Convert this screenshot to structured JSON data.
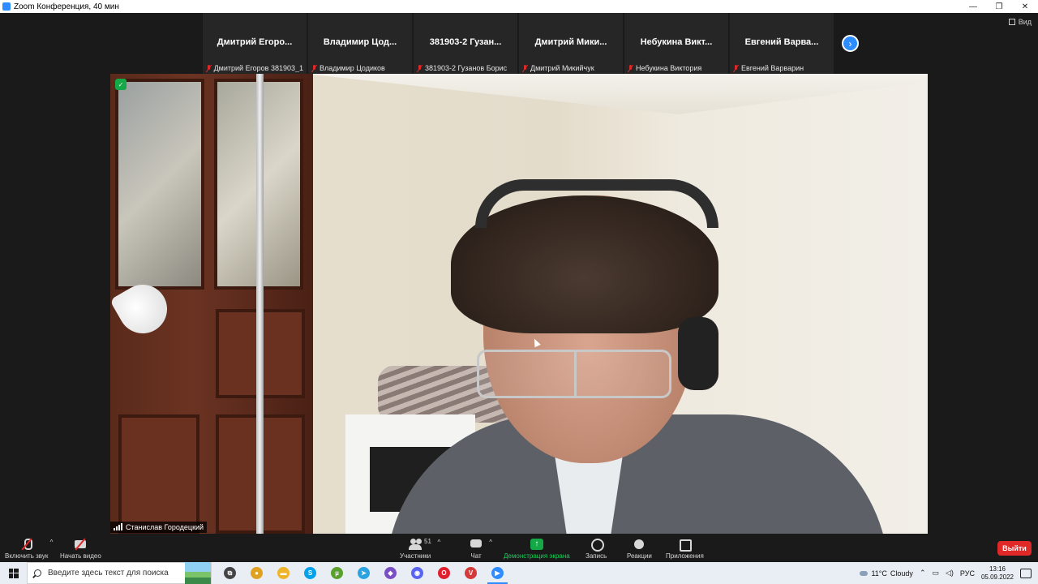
{
  "window": {
    "title": "Zoom Конференция, 40 мин",
    "controls": [
      "—",
      "❐",
      "✕"
    ]
  },
  "view": {
    "label": "Вид"
  },
  "participants_strip": [
    {
      "name": "Дмитрий Егоро...",
      "label": "Дмитрий Егоров 381903_1"
    },
    {
      "name": "Владимир Цод...",
      "label": "Владимир Цодиков"
    },
    {
      "name": "381903-2 Гузан...",
      "label": "381903-2 Гузанов Борис"
    },
    {
      "name": "Дмитрий Мики...",
      "label": "Дмитрий Микийчук"
    },
    {
      "name": "Небукина Викт...",
      "label": "Небукина Виктория"
    },
    {
      "name": "Евгений Варва...",
      "label": "Евгений Варварин"
    }
  ],
  "next_page_icon": "chevron-right-icon",
  "main_video": {
    "speaker_name": "Станислав Городецкий",
    "encryption_icon": "shield-check-icon"
  },
  "controls": {
    "unmute": "Включить звук",
    "start_video": "Начать видео",
    "participants": "Участники",
    "participants_count": "51",
    "chat": "Чат",
    "share_screen": "Демонстрация экрана",
    "record": "Запись",
    "reactions": "Реакции",
    "apps": "Приложения",
    "leave": "Выйти",
    "caret": "^"
  },
  "taskbar": {
    "search_placeholder": "Введите здесь текст для поиска",
    "apps": [
      {
        "name": "task-view",
        "color": "#444444",
        "glyph": "⧉"
      },
      {
        "name": "chrome",
        "color": "#e0a020",
        "glyph": "●"
      },
      {
        "name": "file-explorer",
        "color": "#f0b429",
        "glyph": "▬"
      },
      {
        "name": "skype",
        "color": "#00a2ed",
        "glyph": "S"
      },
      {
        "name": "utorrent",
        "color": "#5aa02c",
        "glyph": "µ"
      },
      {
        "name": "telegram",
        "color": "#2aa3e0",
        "glyph": "➤"
      },
      {
        "name": "visual-studio",
        "color": "#7a4fc4",
        "glyph": "◆"
      },
      {
        "name": "discord",
        "color": "#5865f2",
        "glyph": "◉"
      },
      {
        "name": "opera",
        "color": "#e0202f",
        "glyph": "O"
      },
      {
        "name": "vivaldi",
        "color": "#d43a3a",
        "glyph": "V"
      },
      {
        "name": "zoom",
        "color": "#2d8cff",
        "glyph": "▶"
      }
    ],
    "weather": {
      "temp": "11°C",
      "condition": "Cloudy"
    },
    "language": "РУС",
    "time": "13:16",
    "date": "05.09.2022"
  },
  "colors": {
    "zoom_blue": "#2d8cff",
    "share_green": "#14d257",
    "leave_red": "#e02828"
  }
}
